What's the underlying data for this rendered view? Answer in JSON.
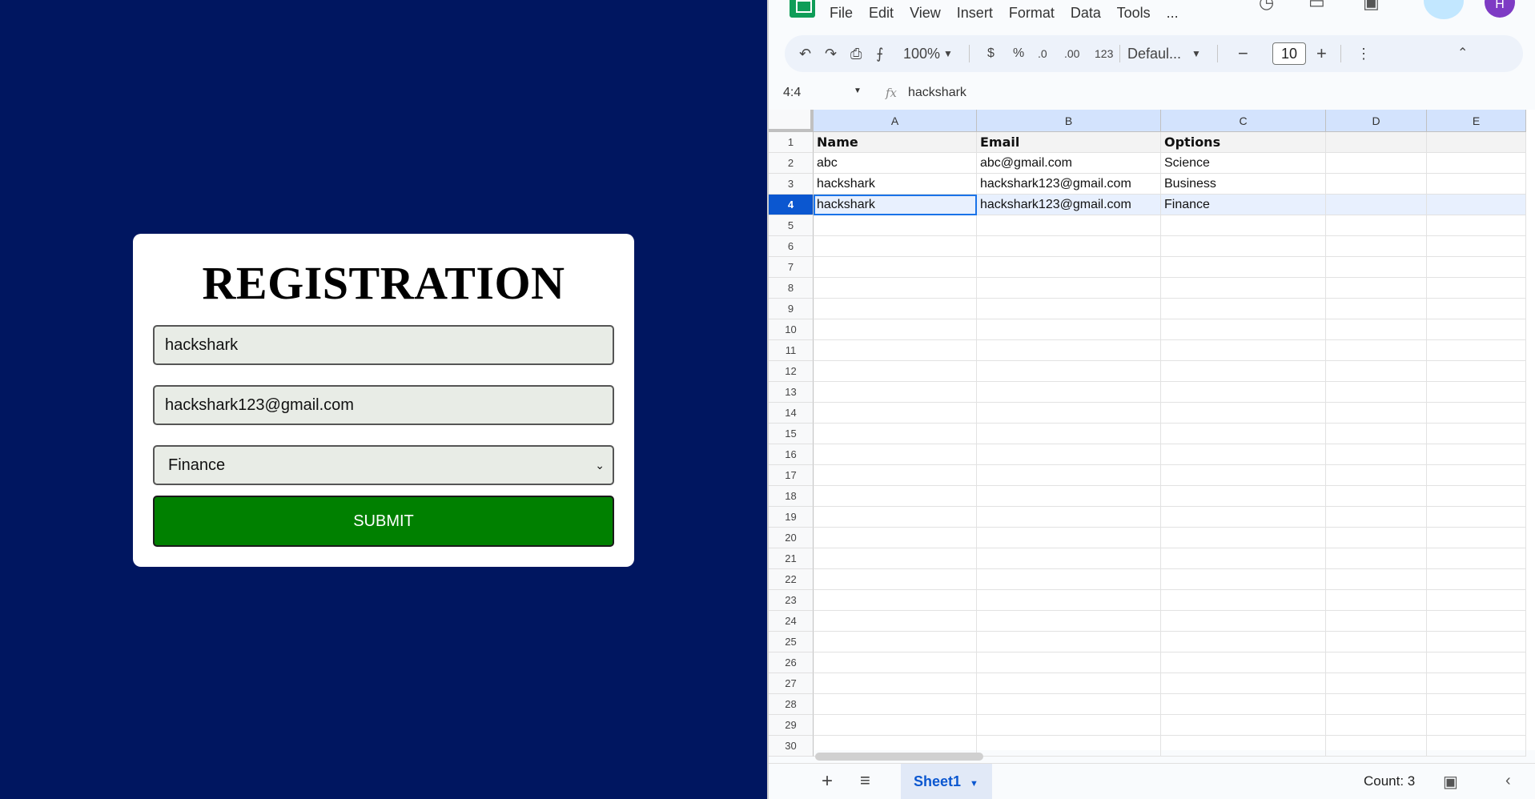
{
  "form": {
    "title": "REGISTRATION",
    "name_value": "hackshark",
    "email_value": "hackshark123@gmail.com",
    "option_selected": "Finance",
    "submit_label": "SUBMIT",
    "background_color": "#001660",
    "submit_color": "#008000"
  },
  "sheets": {
    "menu": [
      "File",
      "Edit",
      "View",
      "Insert",
      "Format",
      "Data",
      "Tools",
      "..."
    ],
    "toolbar": {
      "zoom": "100%",
      "currency": "$",
      "percent": "%",
      "decimal_decrease": ".0",
      "decimal_increase": ".00",
      "number_format": "123",
      "font": "Defaul...",
      "font_size": "10"
    },
    "name_box": "4:4",
    "formula_value": "hackshark",
    "column_headers": [
      "A",
      "B",
      "C",
      "D",
      "E"
    ],
    "row_numbers": [
      "1",
      "2",
      "3",
      "4",
      "5",
      "6",
      "7",
      "8",
      "9",
      "10",
      "11",
      "12",
      "13",
      "14",
      "15",
      "16",
      "17",
      "18",
      "19",
      "20",
      "21",
      "22",
      "23",
      "24",
      "25",
      "26",
      "27",
      "28",
      "29",
      "30"
    ],
    "rows": [
      [
        "Name",
        "Email",
        "Options"
      ],
      [
        "abc",
        "abc@gmail.com",
        "Science"
      ],
      [
        "hackshark",
        "hackshark123@gmail.com",
        "Business"
      ],
      [
        "hackshark",
        "hackshark123@gmail.com",
        "Finance"
      ]
    ],
    "selected_row": 4,
    "sheet_tab": "Sheet1",
    "status": "Count: 3",
    "accent_color": "#0b57d0"
  }
}
